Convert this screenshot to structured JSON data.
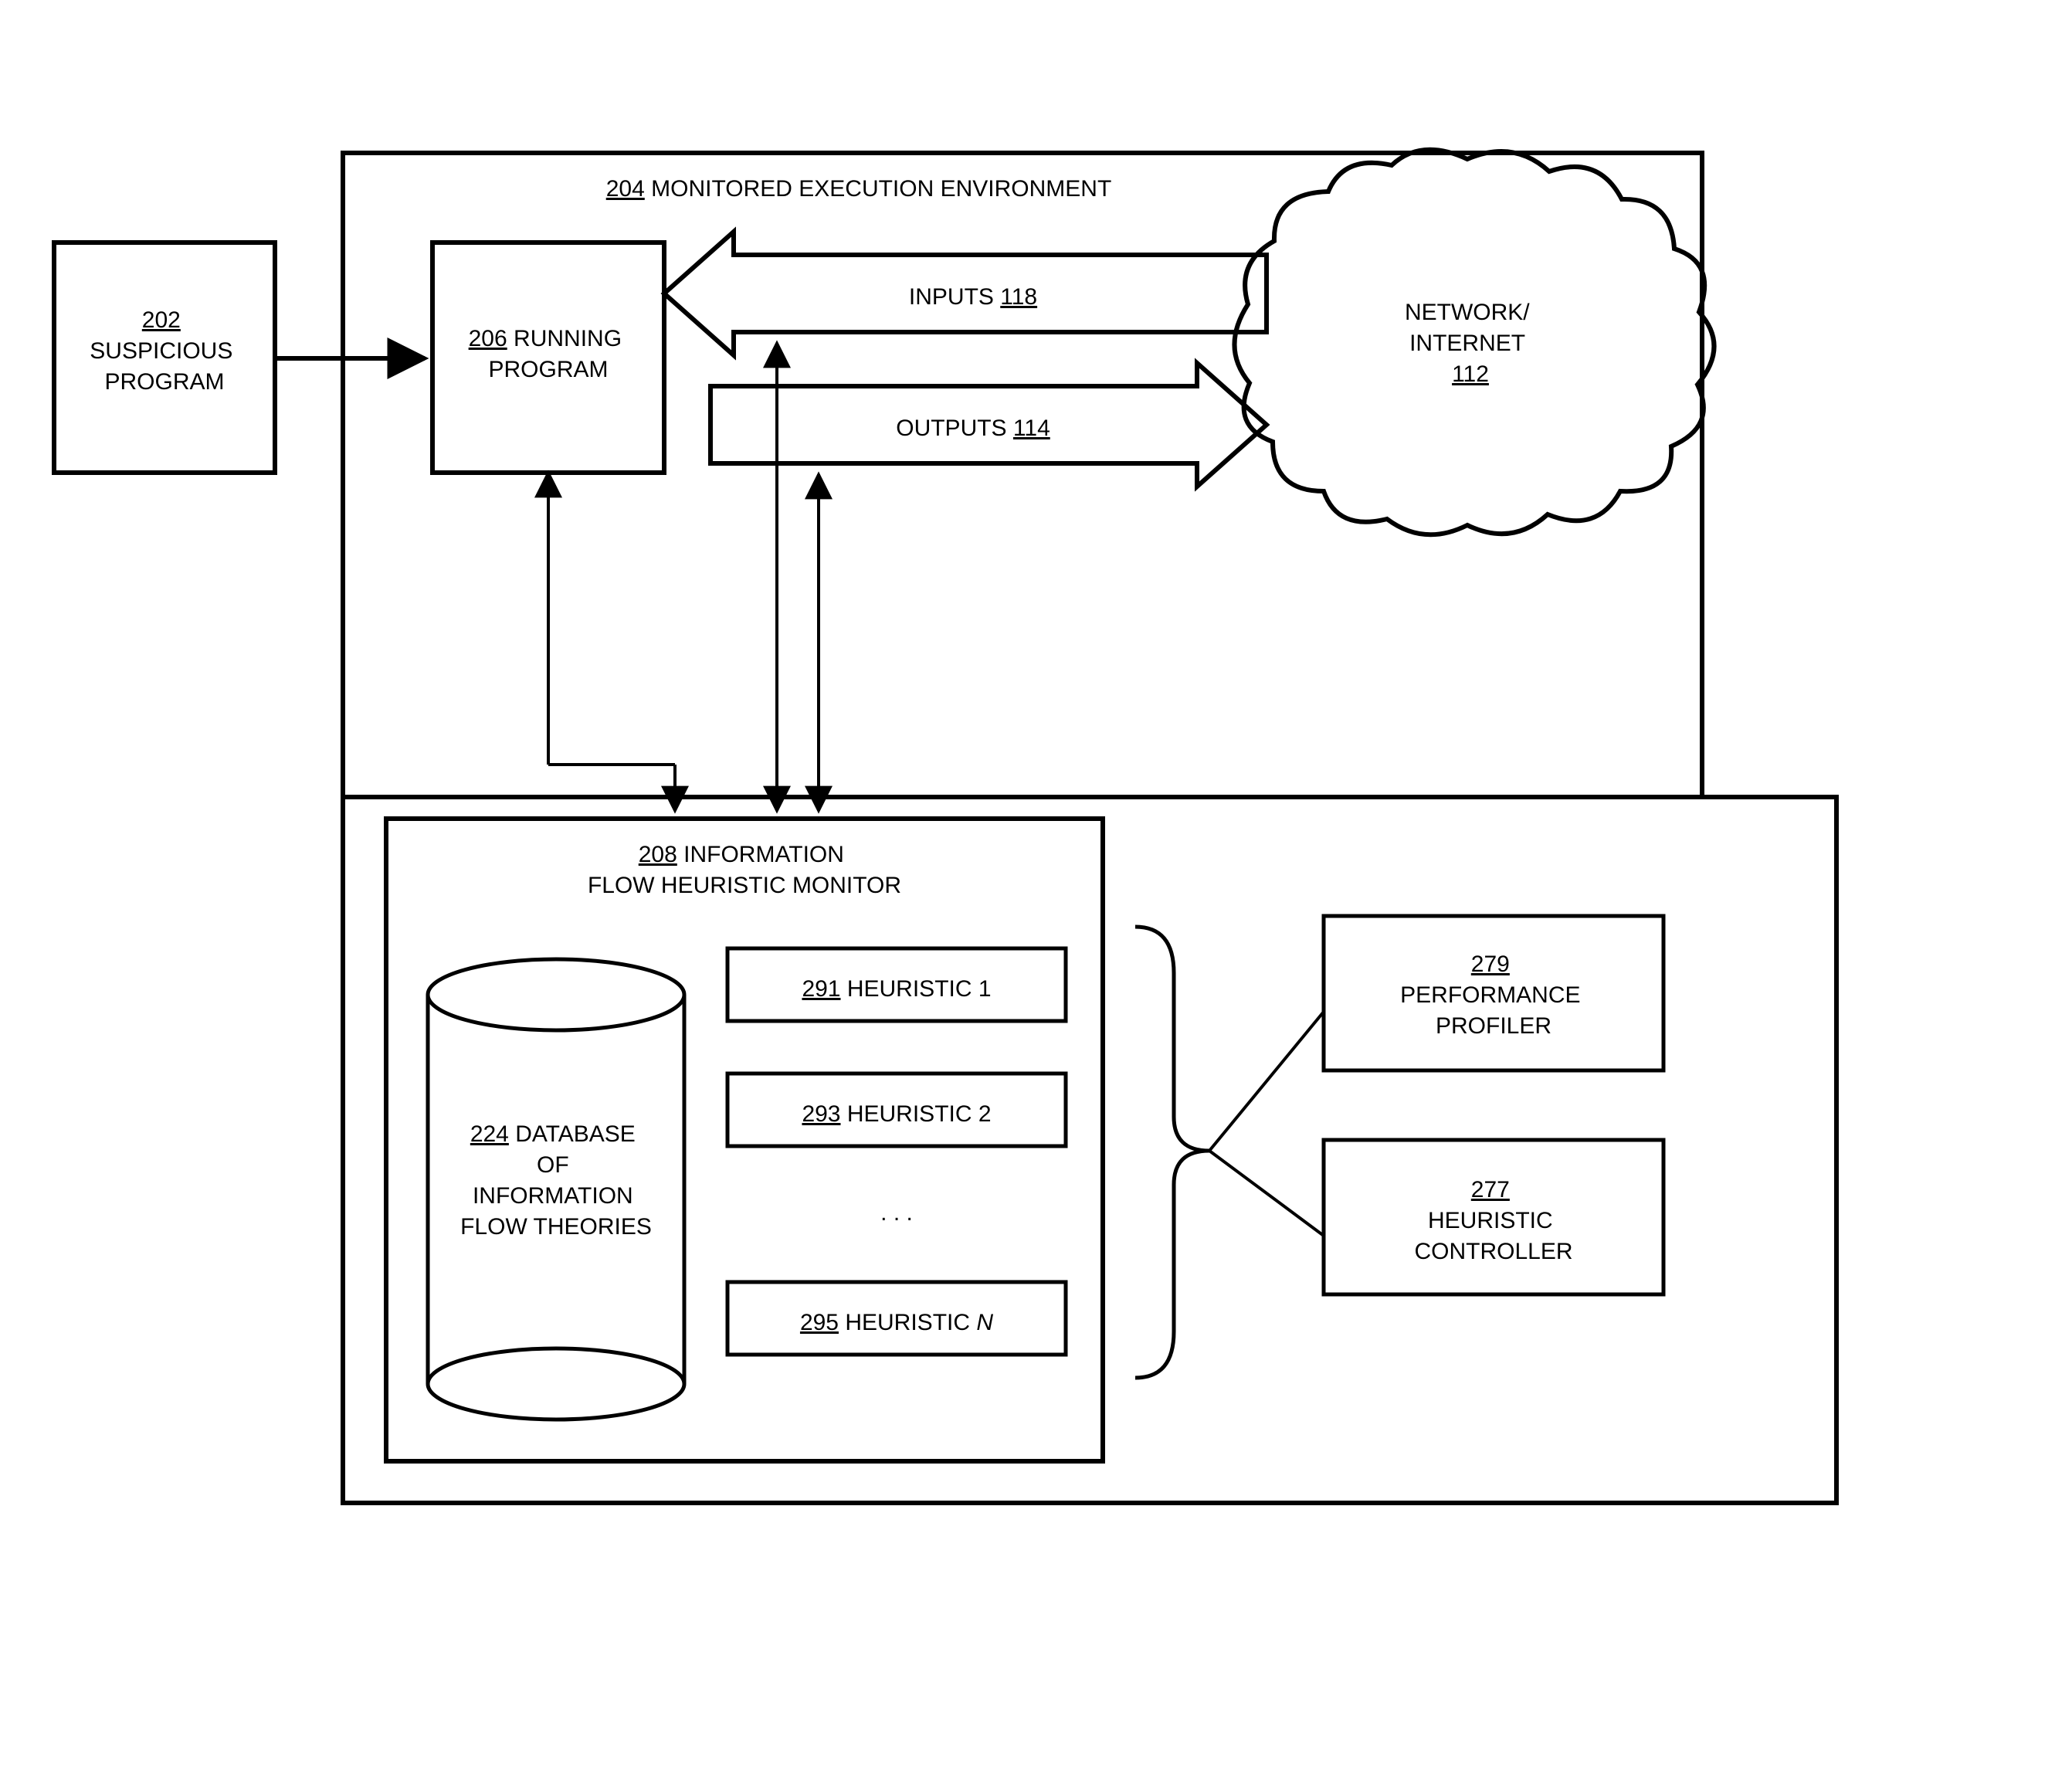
{
  "suspicious": {
    "ref": "202",
    "l1": "SUSPICIOUS",
    "l2": "PROGRAM"
  },
  "env": {
    "ref": "204",
    "title": "MONITORED EXECUTION ENVIRONMENT"
  },
  "running": {
    "ref": "206",
    "l1": "RUNNING",
    "l2": "PROGRAM"
  },
  "inputs": {
    "label": "INPUTS",
    "ref": "118"
  },
  "outputs": {
    "label": "OUTPUTS",
    "ref": "114"
  },
  "network": {
    "l1": "NETWORK/",
    "l2": "INTERNET",
    "ref": "112"
  },
  "monitor": {
    "ref": "208",
    "l1": "INFORMATION",
    "l2": "FLOW HEURISTIC MONITOR"
  },
  "db": {
    "ref": "224",
    "l1": "DATABASE",
    "l2": "OF",
    "l3": "INFORMATION",
    "l4": "FLOW THEORIES"
  },
  "h1": {
    "ref": "291",
    "label": "HEURISTIC 1"
  },
  "h2": {
    "ref": "293",
    "label": "HEURISTIC 2"
  },
  "hn": {
    "ref": "295",
    "label": "HEURISTIC",
    "n": "N"
  },
  "ellipsis": ". . .",
  "profiler": {
    "ref": "279",
    "l1": "PERFORMANCE",
    "l2": "PROFILER"
  },
  "controller": {
    "ref": "277",
    "l1": "HEURISTIC",
    "l2": "CONTROLLER"
  }
}
